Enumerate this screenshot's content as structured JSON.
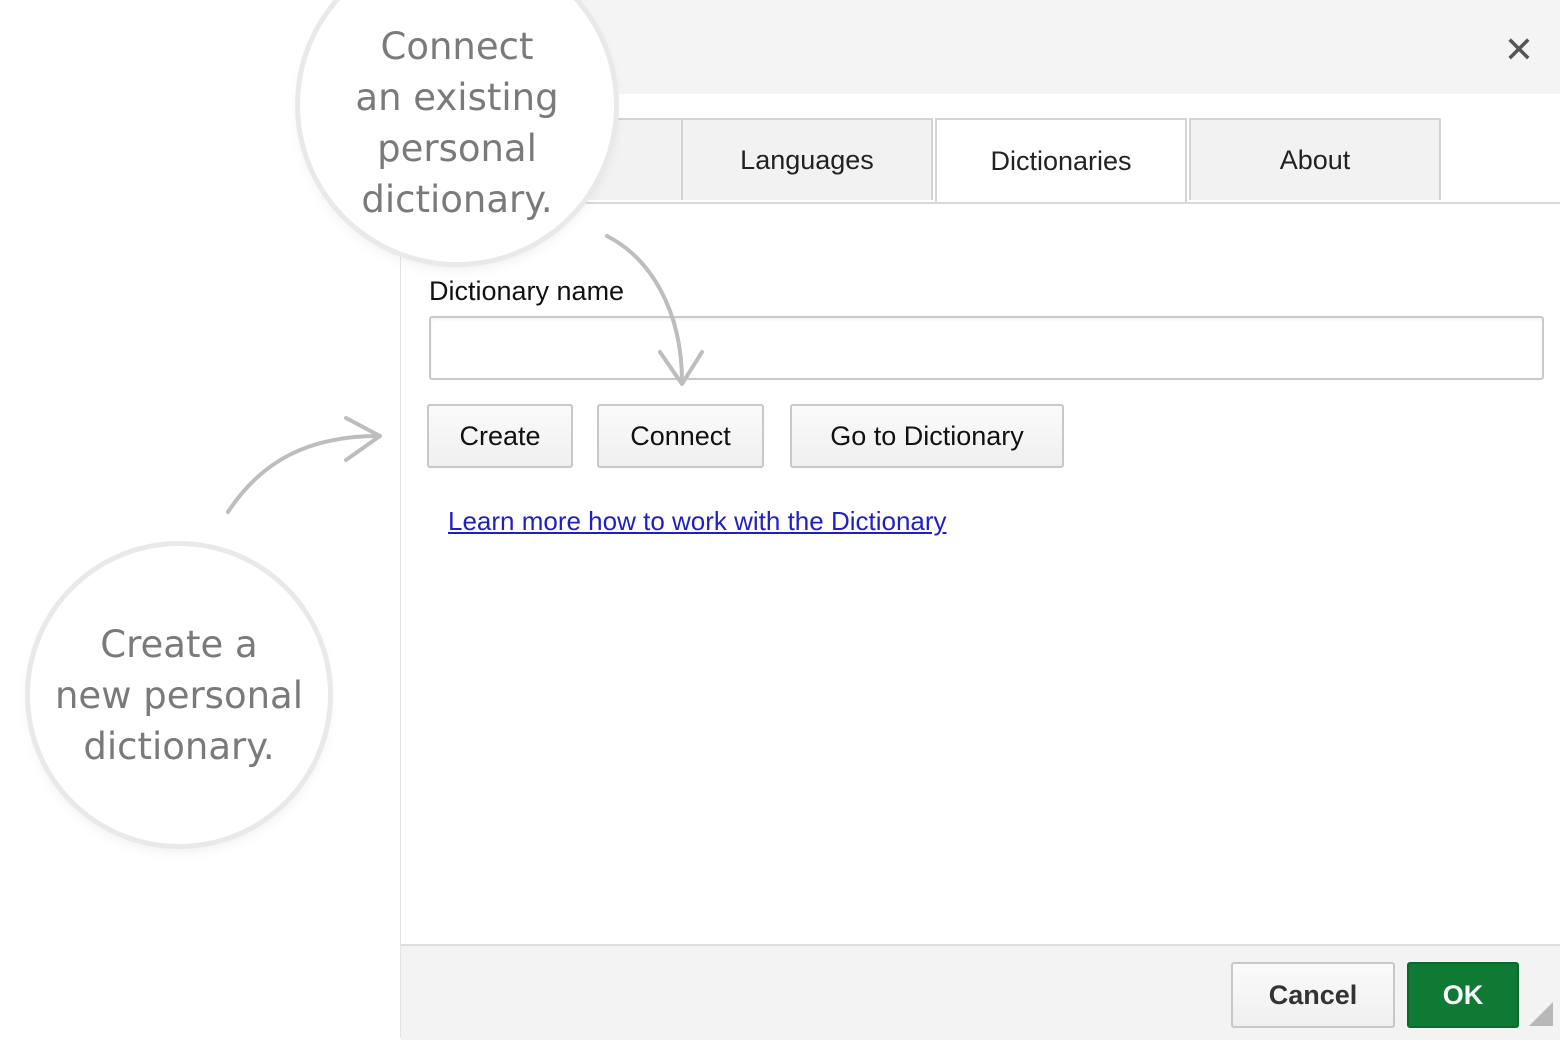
{
  "dialog": {
    "close_icon": "✕",
    "tabs": [
      {
        "label": ""
      },
      {
        "label": "Languages"
      },
      {
        "label": "Dictionaries"
      },
      {
        "label": "About"
      }
    ],
    "active_tab": "Dictionaries",
    "dictionary_name_label": "Dictionary name",
    "dictionary_name_value": "",
    "buttons": {
      "create": "Create",
      "connect": "Connect",
      "go_to_dictionary": "Go to Dictionary"
    },
    "learn_more_link": "Learn more how to work with the Dictionary",
    "footer": {
      "cancel": "Cancel",
      "ok": "OK"
    }
  },
  "callouts": {
    "connect": "Connect\nan existing\npersonal\ndictionary.",
    "create": "Create a\nnew personal\ndictionary."
  },
  "colors": {
    "ok_button": "#0f7a34",
    "link": "#1f1fc8",
    "callout_text": "#7a7a7a"
  }
}
